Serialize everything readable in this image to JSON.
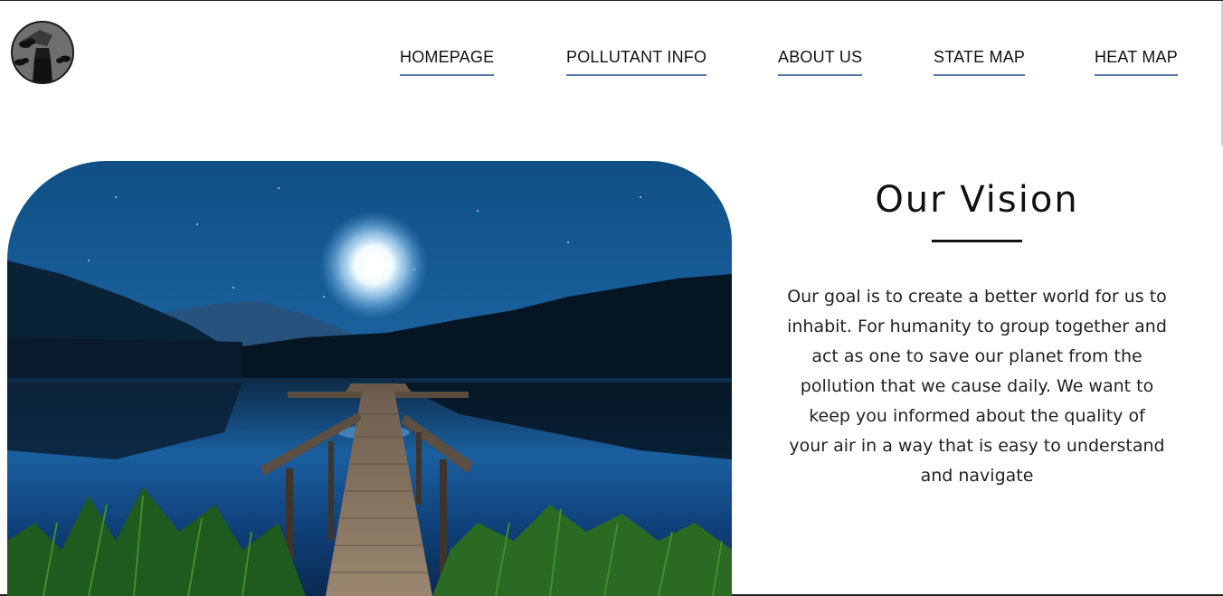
{
  "header": {
    "logo_icon": "factory-smoke-logo-icon",
    "nav": [
      {
        "label": "HOMEPAGE"
      },
      {
        "label": "POLLUTANT INFO"
      },
      {
        "label": "ABOUT US"
      },
      {
        "label": "STATE MAP"
      },
      {
        "label": "HEAT MAP"
      }
    ],
    "accent_color": "#5a78b0"
  },
  "hero": {
    "image": "night-lake-dock-moon-photo"
  },
  "vision": {
    "title": "Our Vision",
    "text": "Our goal is to create a better world for us to inhabit. For humanity to group together and act as one to save our planet from the pollution that we cause daily. We want to keep you informed about the quality of your air in a way that is easy to understand and navigate"
  }
}
